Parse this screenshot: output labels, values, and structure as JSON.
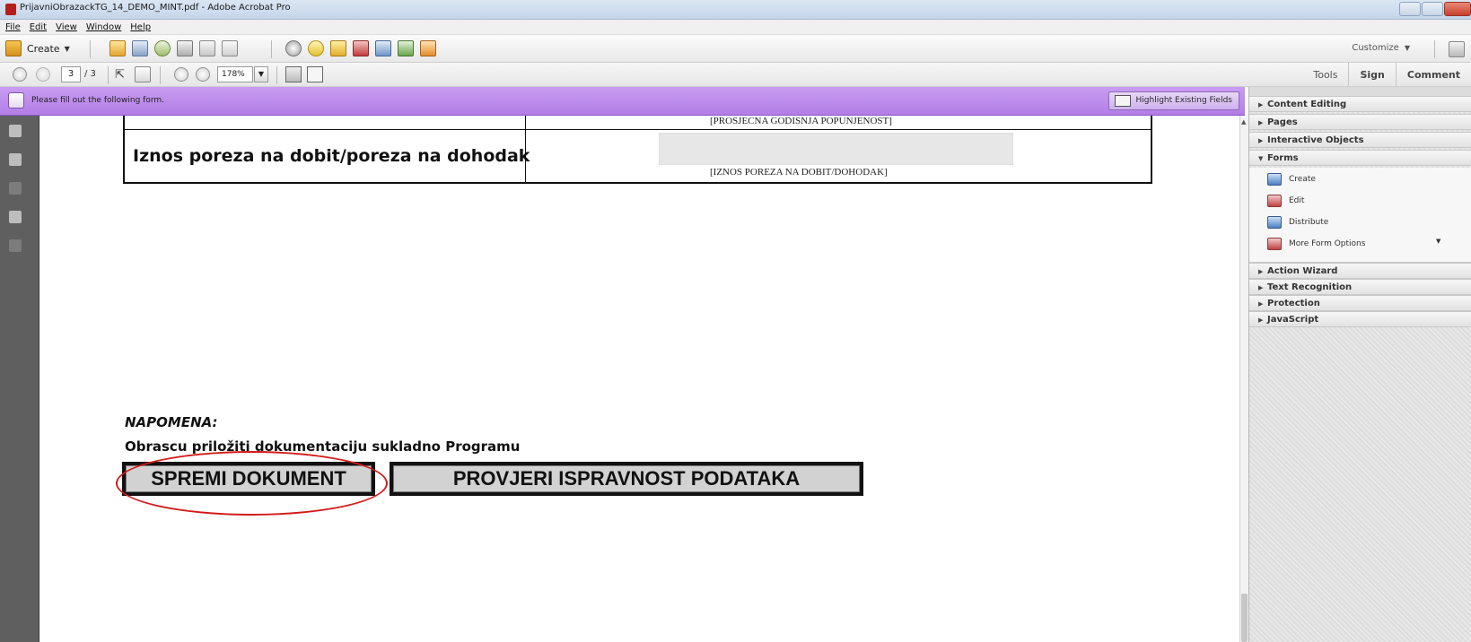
{
  "window": {
    "title": "PrijavniObrazackTG_14_DEMO_MINT.pdf - Adobe Acrobat Pro"
  },
  "menu": [
    "File",
    "Edit",
    "View",
    "Window",
    "Help"
  ],
  "toolbar": {
    "create_label": "Create",
    "customize_label": "Customize"
  },
  "navigation": {
    "current_page": "3",
    "page_count": "/ 3",
    "zoom": "178%"
  },
  "right_tabs": {
    "tools": "Tools",
    "sign": "Sign",
    "comment": "Comment"
  },
  "form_bar": {
    "message": "Please fill out the following form.",
    "highlight_button": "Highlight Existing Fields"
  },
  "document": {
    "prosjek_caption": "[PROSJECNA GODISNJA POPUNJENOST]",
    "iznos_label": "Iznos poreza na dobit/poreza na  dohodak",
    "iznos_caption": "[IZNOS POREZA NA DOBIT/DOHODAK]",
    "napomena": "NAPOMENA:",
    "note_text": "Obrascu priložiti dokumentaciju sukladno Programu",
    "save_button": "SPREMI DOKUMENT",
    "check_button": "PROVJERI ISPRAVNOST PODATAKA"
  },
  "tools_pane": {
    "panels": [
      "Content Editing",
      "Pages",
      "Interactive Objects",
      "Forms",
      "Action Wizard",
      "Text Recognition",
      "Protection",
      "JavaScript"
    ],
    "forms_items": [
      "Create",
      "Edit",
      "Distribute",
      "More Form Options"
    ]
  },
  "colors": {
    "form_bar": "#b88ae9",
    "annotation_red": "#d31a1a",
    "button_gray": "#d2d2d2"
  }
}
